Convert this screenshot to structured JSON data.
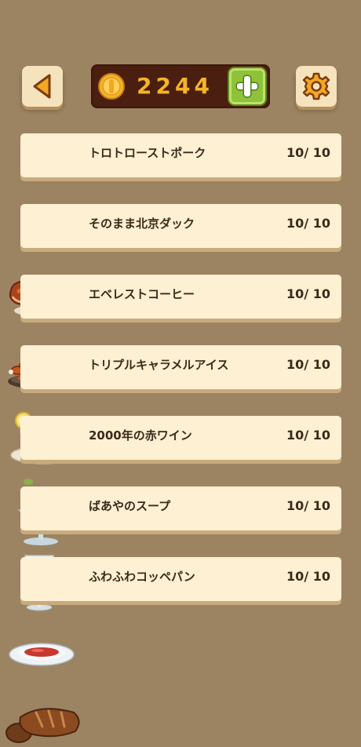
{
  "header": {
    "back_icon": "triangle-left-icon",
    "coins": "2244",
    "coin_icon": "coin-icon",
    "add_icon": "plus-icon",
    "settings_icon": "gear-icon",
    "colors": {
      "background": "#9c8462",
      "panel": "#4a1f10",
      "coin_text": "#f5b428",
      "add_button": "#8fc23a",
      "accent_orange": "#f0a020"
    }
  },
  "dishes": [
    {
      "name": "トロトローストポーク",
      "count": "10/ 10",
      "icon": "roast-pork-icon"
    },
    {
      "name": "そのまま北京ダック",
      "count": "10/ 10",
      "icon": "peking-duck-icon"
    },
    {
      "name": "エベレストコーヒー",
      "count": "10/ 10",
      "icon": "coffee-cup-icon"
    },
    {
      "name": "トリプルキャラメルアイス",
      "count": "10/ 10",
      "icon": "ice-cream-icon"
    },
    {
      "name": "2000年の赤ワイン",
      "count": "10/ 10",
      "icon": "red-wine-icon"
    },
    {
      "name": "ばあやのスープ",
      "count": "10/ 10",
      "icon": "soup-bowl-icon"
    },
    {
      "name": "ふわふわコッペパン",
      "count": "10/ 10",
      "icon": "bread-icon"
    }
  ]
}
